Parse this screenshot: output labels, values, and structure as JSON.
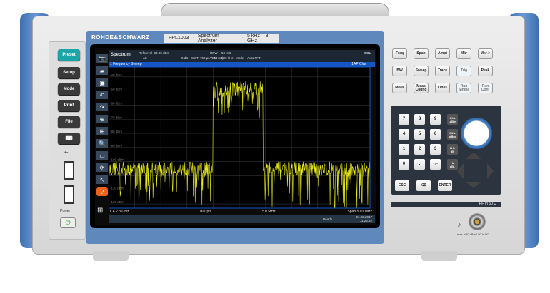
{
  "brand": "ROHDE&SCHWARZ",
  "model": {
    "name": "FPL1003",
    "type": "Spectrum Analyzer",
    "range": "5 kHz – 3 GHz"
  },
  "left_panel": {
    "buttons": [
      "Preset",
      "Setup",
      "Mode",
      "Print",
      "File"
    ],
    "power_label": "Power",
    "preset_color": "#1aa6a8"
  },
  "screen": {
    "app": "Spectrum",
    "ref_level_label": "Ref Level",
    "ref_level": "-33.00 dBm",
    "att_label": "Att",
    "att": "5 dB",
    "swt_label": "SWT",
    "swt": "759 µs (~45 ms)",
    "rbw_label": "RBW",
    "rbw": "50 kHz",
    "vbw_label": "VBW",
    "vbw": "500 kHz",
    "mode_label": "Mode",
    "mode": "Auto FFT",
    "sgl": "SGL",
    "window_title": "1 Frequency Sweep",
    "trace_label": "1AP Clrw",
    "footer": {
      "cf": "CF 2.3 GHz",
      "pts": "1001 pts",
      "div": "5.0 MHz/",
      "span": "Span 50.0 MHz"
    },
    "status": {
      "ready": "Ready",
      "date": "21.02.2017",
      "time": "11:23:32"
    }
  },
  "chart_data": {
    "type": "line",
    "ylabels": [
      "-40 dBm",
      "-50 dBm",
      "-60 dBm",
      "-70 dBm",
      "-80 dBm",
      "-90 dBm",
      "-100 dBm",
      "-110 dBm",
      "-120 dBm",
      "-130 dBm"
    ],
    "yticks": [
      -40,
      -50,
      -60,
      -70,
      -80,
      -90,
      -100,
      -110,
      -120,
      -130
    ],
    "ylim": [
      -133,
      -33
    ],
    "xlim_ghz": [
      2.275,
      2.325
    ],
    "grid": true,
    "trace_color": "#e8e81a",
    "noise_floor_dbm": -105,
    "channel": {
      "start_ghz": 2.295,
      "stop_ghz": 2.3045,
      "level_dbm": -48
    }
  },
  "right_keys": [
    [
      "Freq",
      "Span",
      "Ampt",
      "Mkr",
      "Mkr->"
    ],
    [
      "BW",
      "Sweep",
      "Trace",
      "Trig",
      "Peak"
    ],
    [
      "Meas",
      "Meas Config",
      "Lines",
      "Run Single",
      "Run Cont"
    ]
  ],
  "keypad": [
    [
      "7",
      "8",
      "9"
    ],
    [
      "4",
      "5",
      "6"
    ],
    [
      "1",
      "2",
      "3"
    ],
    [
      "0",
      ".",
      "+/-"
    ]
  ],
  "unit_keys": [
    [
      "GHz",
      "-dBm"
    ],
    [
      "MHz",
      "dBm"
    ],
    [
      "kHz",
      "dB"
    ],
    [
      "Hz",
      "dB.."
    ]
  ],
  "bottom_keys": [
    "ESC",
    "⌫",
    "ENTER"
  ],
  "rf_label": "RF In 50 Ω",
  "rf_warning": "max. +30 dBm / 50 V DC"
}
